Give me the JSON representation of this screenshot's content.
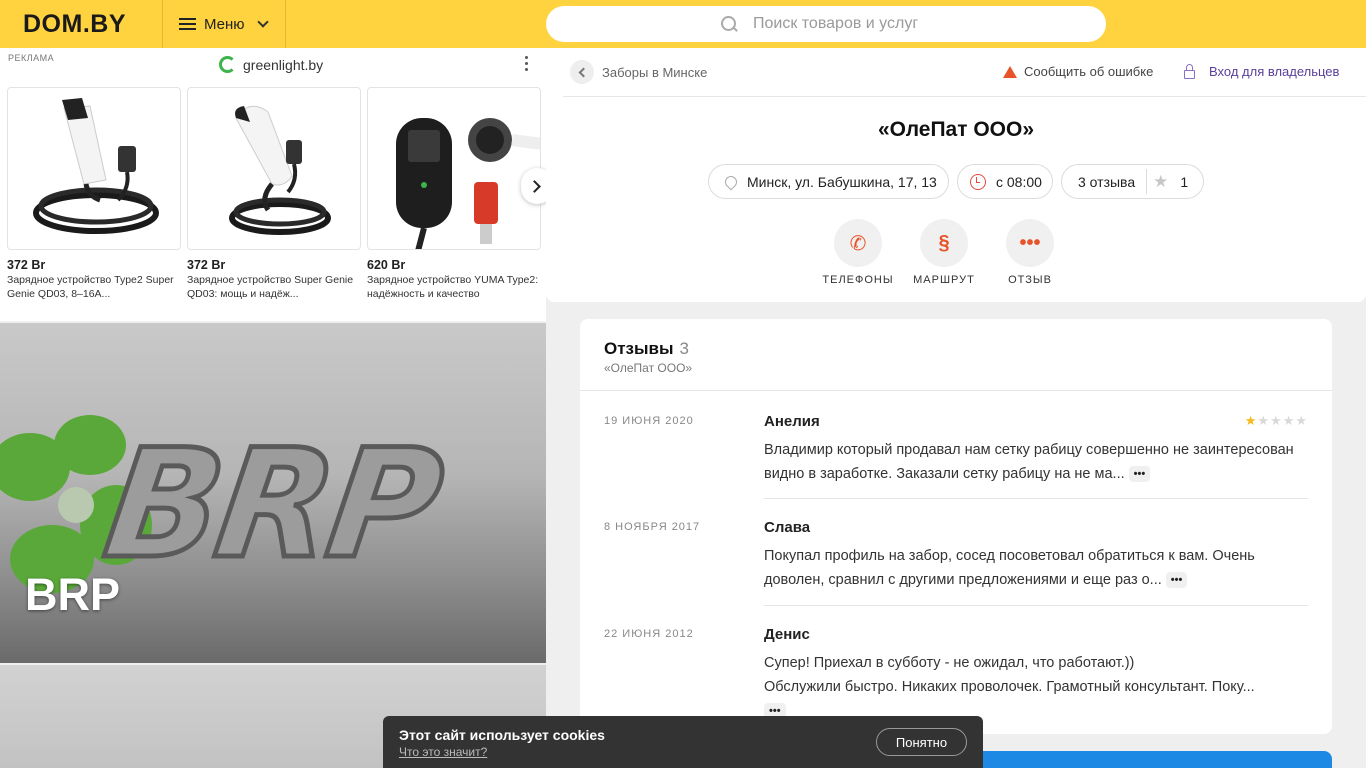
{
  "header": {
    "logo": "DOM.BY",
    "menu_label": "Меню",
    "search_placeholder": "Поиск товаров и услуг"
  },
  "ad": {
    "label": "РЕКЛАМА",
    "brand": "greenlight.by",
    "cards": [
      {
        "price": "372 Br",
        "desc": "Зарядное устройство Type2 Super Genie QD03, 8–16A..."
      },
      {
        "price": "372 Br",
        "desc": "Зарядное устройство Super Genie QD03: мощь и надёж..."
      },
      {
        "price": "620 Br",
        "desc": "Зарядное устройство YUMA Type2: надёжность и качество"
      }
    ]
  },
  "banner": {
    "title": "BRP"
  },
  "company": {
    "breadcrumb": "Заборы в Минске",
    "report_label": "Сообщить об ошибке",
    "owner_label": "Вход для владельцев",
    "name": "«ОлеПат ООО»",
    "address": "Минск, ул. Бабушкина, 17, 13",
    "hours": "с 08:00",
    "reviews_count": "3 отзыва",
    "rating": "1",
    "actions": {
      "phones": "ТЕЛЕФОНЫ",
      "route": "МАРШРУТ",
      "review": "ОТЗЫВ"
    }
  },
  "reviews": {
    "title": "Отзывы",
    "count": "3",
    "subtitle": "«ОлеПат ООО»",
    "more_label": "•••",
    "items": [
      {
        "date": "19 ИЮНЯ 2020",
        "author": "Анелия",
        "text": "Владимир который продавал нам сетку рабицу совершенно не заинтересован видно в заработке. Заказали сетку рабицу на не ма...",
        "stars": 1
      },
      {
        "date": "8 НОЯБРЯ 2017",
        "author": "Слава",
        "text": "Покупал профиль на забор, сосед посоветовал обратиться к вам. Очень доволен, сравнил с другими предложениями и еще раз о..."
      },
      {
        "date": "22 ИЮНЯ 2012",
        "author": "Денис",
        "text_line1": "Супер! Приехал в субботу - не ожидал, что работают.))",
        "text_line2": "Обслужили быстро. Никаких проволочек. Грамотный консультант. Поку..."
      }
    ]
  },
  "cookie": {
    "title": "Этот сайт использует cookies",
    "link": "Что это значит?",
    "button": "Понятно"
  },
  "colors": {
    "header_bg": "#ffd33f",
    "accent": "#e8542a",
    "owner_link": "#5a3e9a",
    "star_on": "#f5b91a"
  }
}
